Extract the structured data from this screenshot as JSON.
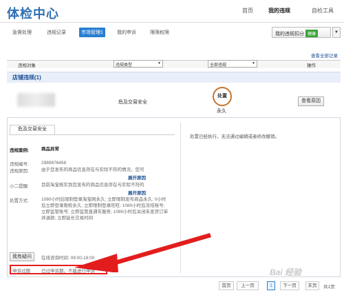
{
  "header": {
    "logo": "体检中心",
    "nav": [
      "首页",
      "我的违规",
      "自检工具"
    ]
  },
  "tabs": [
    "急需处理",
    "违规记录",
    "市场管理1",
    "我的申诉",
    "限限权限"
  ],
  "score_button": {
    "label": "我的违规扣分",
    "badge": "健康",
    "arrow": "▼"
  },
  "view_all_link": "查看全部记录",
  "columns": {
    "object": "违规对象",
    "type_select": "违规类型",
    "all_select": "全部违规",
    "action": "操作",
    "arrow": "▼"
  },
  "store_section": {
    "title": "店铺违规(1)"
  },
  "record": {
    "category": "危及交易安全",
    "status_circle": "处置",
    "duration": "永久",
    "action_button": "查看原因"
  },
  "detail": {
    "tab": "危及交易安全",
    "case_label": "违规案例:",
    "case_value": "商品异常",
    "id_label": "违规编号:",
    "id_value": "2989876458",
    "reason_label": "违规原因:",
    "reason_value": "由于您发布的商品信息存在与实际不符的情况，您可",
    "expand1": "展开原因",
    "tip_label": "小二提醒:",
    "tip_value": "目前淘宝核实到您发布的商品信息存在与实际不符的",
    "expand2": "展开原因",
    "method_label": "处置方式:",
    "method_value": "1080小时后限制登录淘宝网永久; 立即限制发布商品永久; 0小时后立即登录限权永久; 立即限制登录旺旺; 1080小时后冻结账号; 立即监管账号; 立即监管直通车服务; 1080小时后关闭未发货订单并退款; 立即延长交易时间",
    "question_button": "我有疑问",
    "online_time": "在线咨询时间: 09:00-18:00",
    "appeal_label": "申诉过期",
    "appeal_value": "已过申诉期，不能进行申诉",
    "right_text": "处置已经执行，无法通过编辑或者修改撤销。"
  },
  "pagination": {
    "first": "首页",
    "prev": "上一页",
    "current": "1",
    "next": "下一页",
    "last": "末页",
    "total": "共1页"
  },
  "watermark": "Bai 经验",
  "colors": {
    "accent": "#2a7fd0",
    "brand": "#2e6fb4",
    "highlight": "#e31d1d",
    "badge": "#3aa43a"
  }
}
